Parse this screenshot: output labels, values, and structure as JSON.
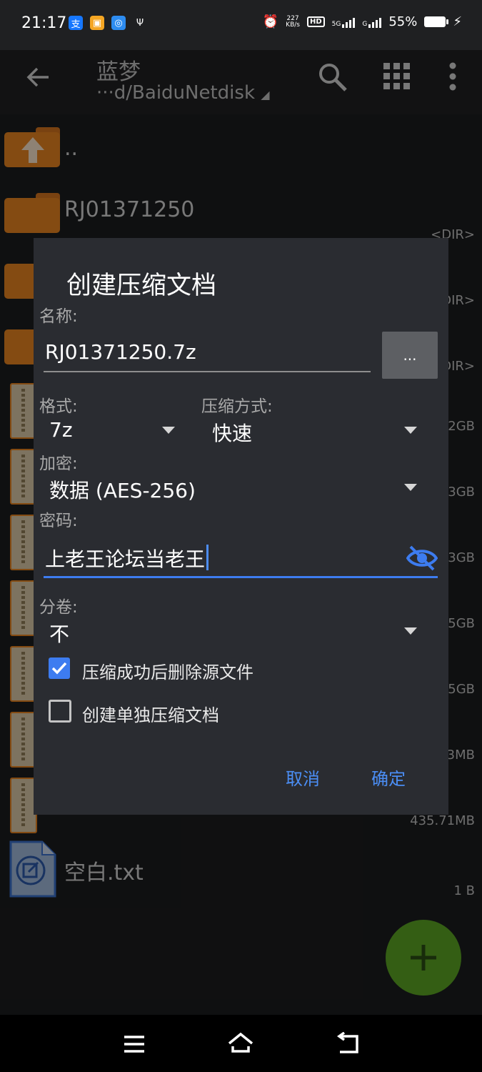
{
  "status_bar": {
    "time": "21:17",
    "net_speed_value": "227",
    "net_speed_unit": "KB/s",
    "hd_badge": "HD",
    "network_5g": "5G",
    "network_g": "G",
    "battery_percent": "55%",
    "app_icons": [
      "alipay-icon",
      "gallery-icon",
      "browser-icon",
      "usb-icon"
    ]
  },
  "toolbar": {
    "title": "蓝梦",
    "path": "···d/BaiduNetdisk"
  },
  "file_list": [
    {
      "name": "..",
      "meta": "",
      "type": "parent"
    },
    {
      "name": "RJ01371250",
      "meta": "<DIR>",
      "type": "folder"
    },
    {
      "name": "",
      "meta": "<DIR>",
      "type": "folder"
    },
    {
      "name": "",
      "meta": "<DIR>",
      "type": "folder"
    },
    {
      "name": "",
      "meta": "2GB",
      "type": "archive"
    },
    {
      "name": "",
      "meta": "3GB",
      "type": "archive"
    },
    {
      "name": "",
      "meta": "3GB",
      "type": "archive"
    },
    {
      "name": "",
      "meta": "5GB",
      "type": "archive"
    },
    {
      "name": "",
      "meta": "5GB",
      "type": "archive"
    },
    {
      "name": "",
      "meta": "3MB",
      "type": "archive"
    },
    {
      "name": "",
      "meta": "435.71MB",
      "type": "archive"
    },
    {
      "name": "空白.txt",
      "meta": "1 B",
      "type": "text"
    }
  ],
  "dialog": {
    "title": "创建压缩文档",
    "name_label": "名称:",
    "name_value": "RJ01371250.7z",
    "browse_label": "...",
    "format_label": "格式:",
    "format_value": "7z",
    "method_label": "压缩方式:",
    "method_value": "快速",
    "encryption_label": "加密:",
    "encryption_value": "数据 (AES-256)",
    "password_label": "密码:",
    "password_value": "上老王论坛当老王",
    "split_label": "分卷:",
    "split_value": "不",
    "delete_source_label": "压缩成功后删除源文件",
    "delete_source_checked": true,
    "separate_archives_label": "创建单独压缩文档",
    "separate_archives_checked": false,
    "cancel_label": "取消",
    "ok_label": "确定"
  },
  "colors": {
    "accent": "#4b8ef5",
    "folder": "#e3811f",
    "fab": "#5aa324",
    "dialog_bg": "#2a2c31"
  }
}
